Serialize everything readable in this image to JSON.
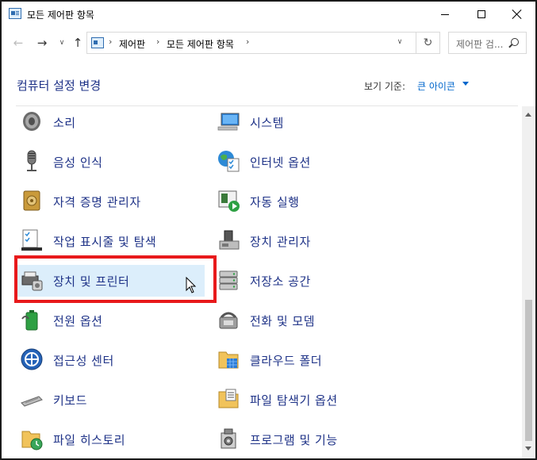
{
  "window": {
    "title": "모든 제어판 항목"
  },
  "navigation": {
    "breadcrumbs": [
      "제어판",
      "모든 제어판 항목"
    ],
    "search_placeholder": "제어판 검..."
  },
  "header": {
    "title": "컴퓨터 설정 변경",
    "view_label": "보기 기준:",
    "view_value": "큰 아이콘"
  },
  "items": [
    {
      "label": "소리",
      "icon": "speaker-icon"
    },
    {
      "label": "시스템",
      "icon": "computer-icon"
    },
    {
      "label": "음성 인식",
      "icon": "microphone-icon"
    },
    {
      "label": "인터넷 옵션",
      "icon": "globe-checklist-icon"
    },
    {
      "label": "자격 증명 관리자",
      "icon": "vault-icon"
    },
    {
      "label": "자동 실행",
      "icon": "autoplay-icon"
    },
    {
      "label": "작업 표시줄 및 탐색",
      "icon": "taskbar-icon"
    },
    {
      "label": "장치 관리자",
      "icon": "device-manager-icon"
    },
    {
      "label": "장치 및 프린터",
      "icon": "printer-icon"
    },
    {
      "label": "저장소 공간",
      "icon": "storage-drives-icon"
    },
    {
      "label": "전원 옵션",
      "icon": "battery-icon"
    },
    {
      "label": "전화 및 모뎀",
      "icon": "phone-fax-icon"
    },
    {
      "label": "접근성 센터",
      "icon": "accessibility-icon"
    },
    {
      "label": "클라우드 폴더",
      "icon": "cloud-folder-icon"
    },
    {
      "label": "키보드",
      "icon": "keyboard-icon"
    },
    {
      "label": "파일 탐색기 옵션",
      "icon": "folder-options-icon"
    },
    {
      "label": "파일 히스토리",
      "icon": "file-history-icon"
    },
    {
      "label": "프로그램 및 기능",
      "icon": "programs-icon"
    }
  ],
  "selected_item": "장치 및 프린터",
  "colors": {
    "link": "#1e3287",
    "accent": "#0066cc",
    "selection": "#dceefb",
    "highlight_box": "#e8191b"
  }
}
